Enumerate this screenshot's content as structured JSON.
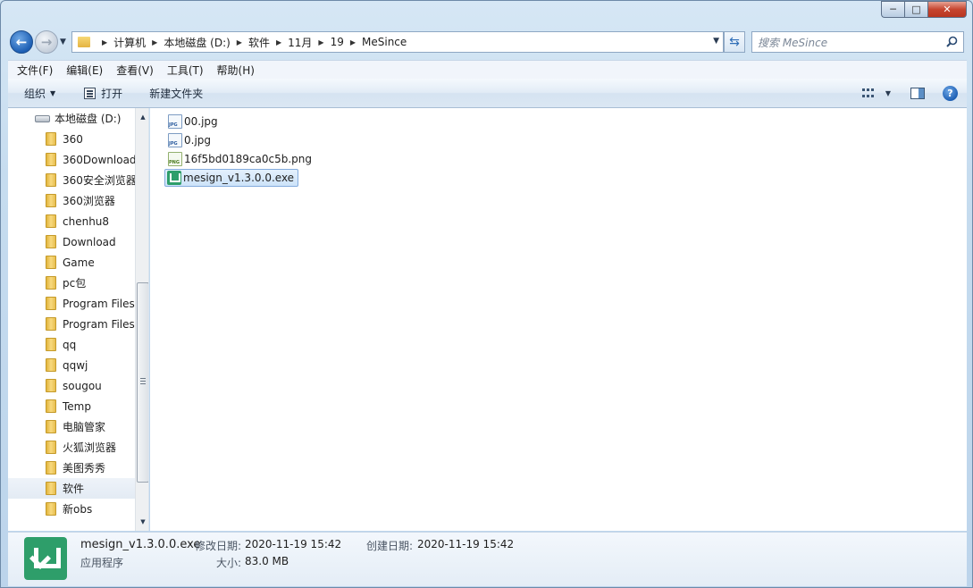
{
  "window": {
    "caption": {
      "minimize": "─",
      "maximize": "□",
      "close": "✕"
    }
  },
  "nav": {
    "back_glyph": "←",
    "forward_glyph": "→",
    "history_glyph": "▼"
  },
  "address": {
    "breadcrumbs": [
      "计算机",
      "本地磁盘 (D:)",
      "软件",
      "11月",
      "19",
      "MeSince"
    ],
    "separator": "▶",
    "dropdown_glyph": "▼",
    "refresh_glyph": "⇆"
  },
  "search": {
    "placeholder": "搜索 MeSince"
  },
  "menubar": {
    "items": [
      "文件(F)",
      "编辑(E)",
      "查看(V)",
      "工具(T)",
      "帮助(H)"
    ]
  },
  "toolbar": {
    "organize": "组织",
    "organize_arrow": "▼",
    "open": "打开",
    "new_folder": "新建文件夹",
    "views_arrow": "▼",
    "help_glyph": "?"
  },
  "tree": {
    "drive": "本地磁盘 (D:)",
    "folders": [
      "360",
      "360Download",
      "360安全浏览器",
      "360浏览器",
      "chenhu8",
      "Download",
      "Game",
      "pc包",
      "Program Files",
      "Program Files",
      "qq",
      "qqwj",
      "sougou",
      "Temp",
      "电脑管家",
      "火狐浏览器",
      "美图秀秀",
      "软件",
      "新obs"
    ],
    "selected": "软件",
    "scroll_up": "▲",
    "scroll_down": "▼"
  },
  "files": [
    {
      "name": "00.jpg",
      "icon": "jpg-file-icon",
      "selected": false
    },
    {
      "name": "0.jpg",
      "icon": "jpg-file-icon",
      "selected": false
    },
    {
      "name": "16f5bd0189ca0c5b.png",
      "icon": "png-file-icon",
      "selected": false
    },
    {
      "name": "mesign_v1.3.0.0.exe",
      "icon": "mesign-app-icon",
      "selected": true
    }
  ],
  "details": {
    "name": "mesign_v1.3.0.0.exe",
    "type": "应用程序",
    "modified_label": "修改日期:",
    "modified_value": "2020-11-19 15:42",
    "created_label": "创建日期:",
    "created_value": "2020-11-19 15:42",
    "size_label": "大小:",
    "size_value": "83.0 MB"
  },
  "colors": {
    "app_green": "#2e9e6a",
    "selection_border": "#84acdd",
    "toolbar_text": "#1e2b3c"
  }
}
